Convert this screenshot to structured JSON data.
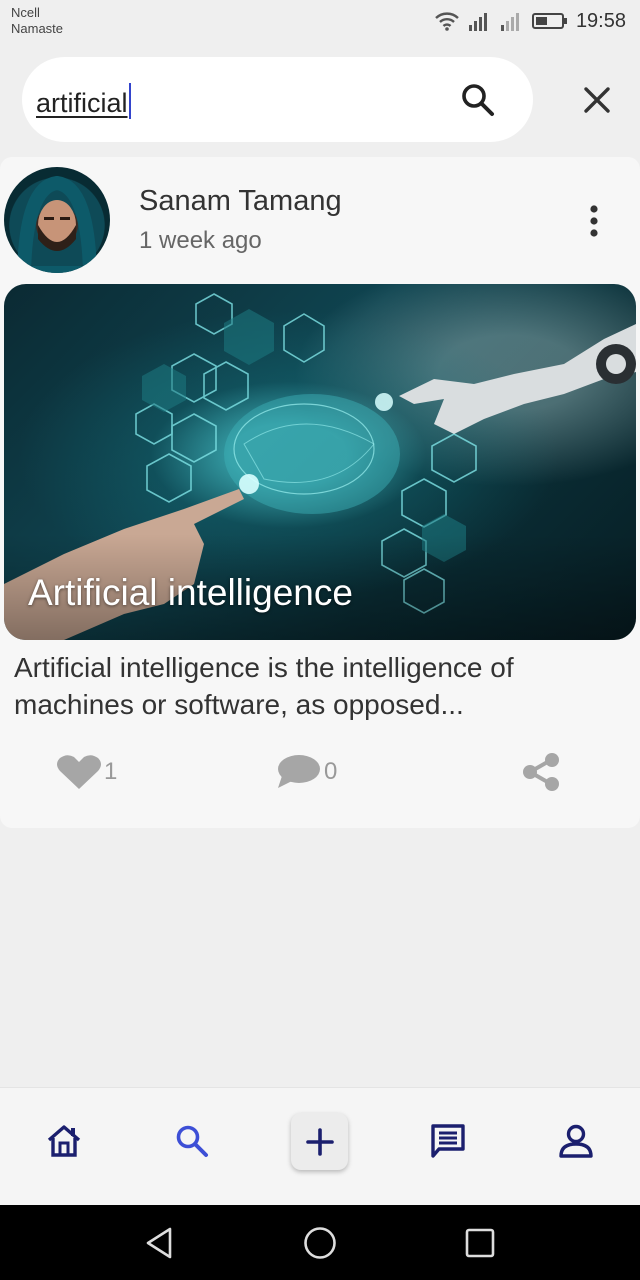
{
  "status_bar": {
    "carrier_1": "Ncell",
    "carrier_2": "Namaste",
    "time": "19:58"
  },
  "search": {
    "value": "artificial",
    "search_icon": "search-icon",
    "clear_icon": "close-icon"
  },
  "post": {
    "author": "Sanam Tamang",
    "posted": "1 week ago",
    "image_title": "Artificial intelligence",
    "excerpt": "Artificial intelligence is the intelligence of machines or software, as opposed...",
    "likes": "1",
    "comments": "0",
    "icons": {
      "like": "heart-icon",
      "comment": "comment-icon",
      "share": "share-icon",
      "menu": "more-vertical-icon"
    }
  },
  "bottom_nav": {
    "items": [
      "home-icon",
      "search-icon",
      "add-icon",
      "chat-icon",
      "profile-icon"
    ],
    "active": "search-icon"
  },
  "colors": {
    "nav_icon": "#1b1f6e",
    "nav_active": "#3d4fd6",
    "caret": "#3344cc",
    "action_icon": "#a6a6a6"
  }
}
